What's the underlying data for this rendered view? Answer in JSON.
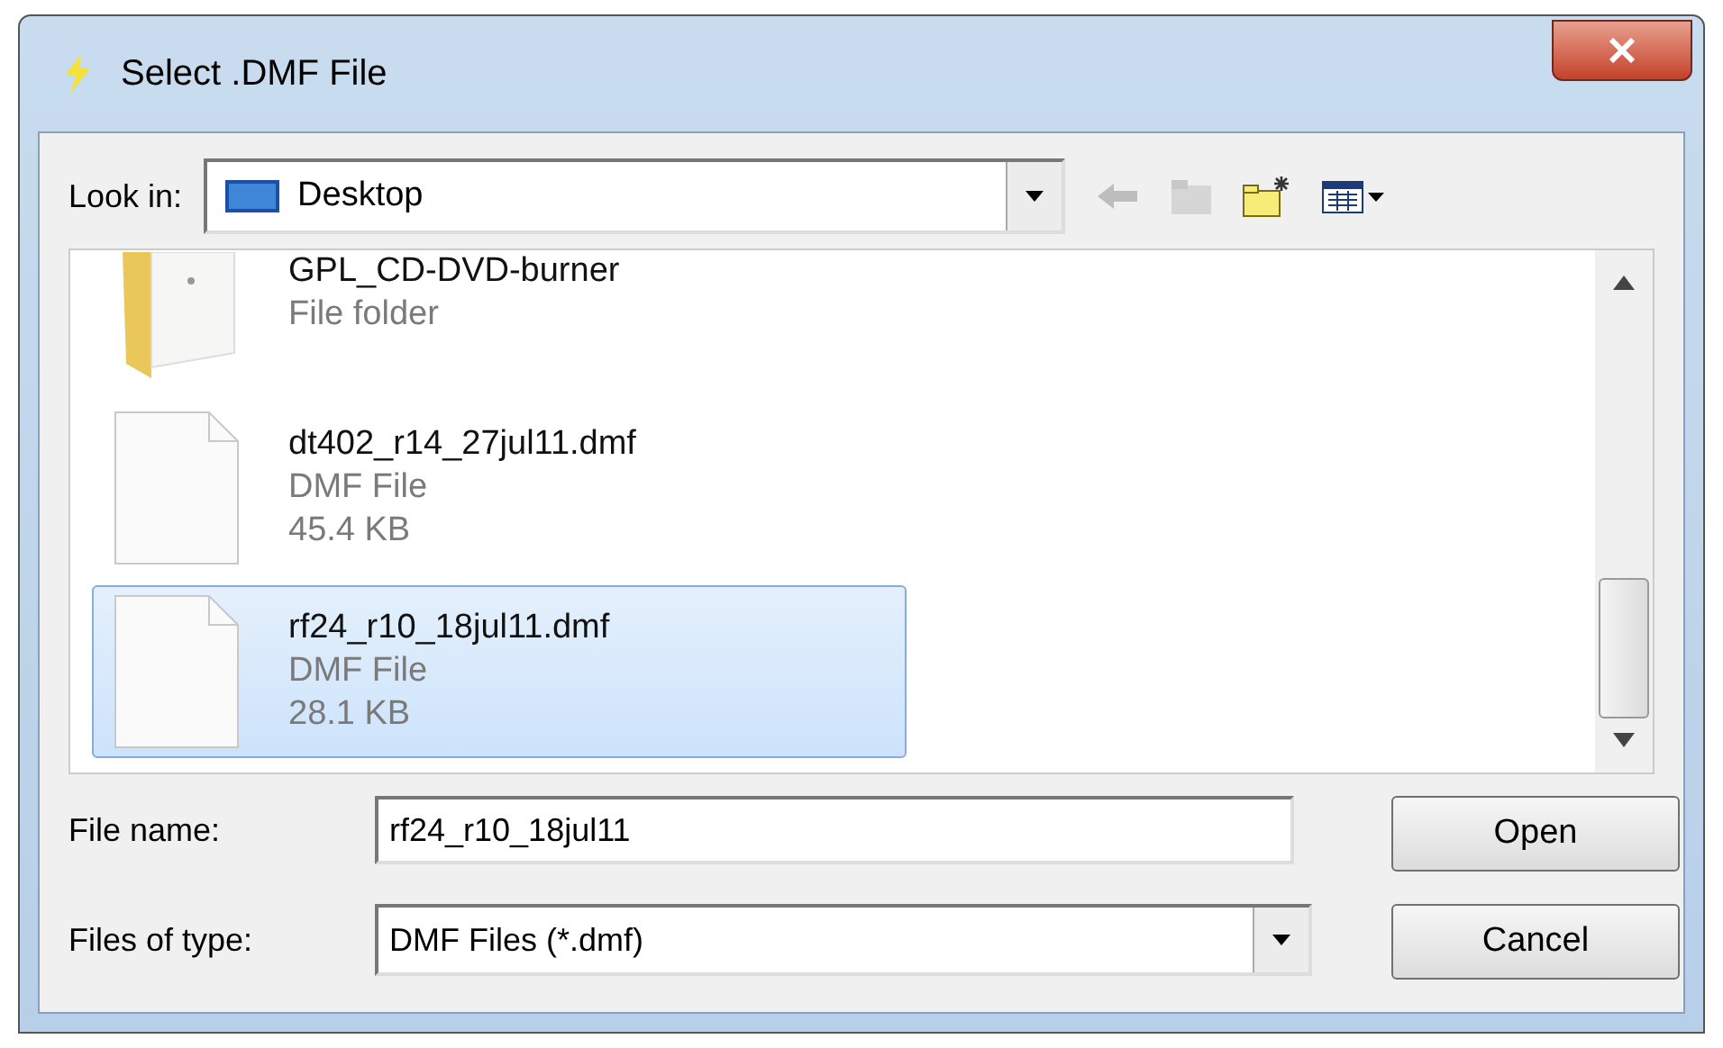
{
  "window": {
    "title": "Select .DMF File"
  },
  "look_in": {
    "label": "Look in:",
    "value": "Desktop"
  },
  "files": [
    {
      "kind": "folder",
      "name": "GPL_CD-DVD-burner",
      "type": "File folder",
      "selected": false
    },
    {
      "kind": "file",
      "name": "dt402_r14_27jul11.dmf",
      "type": "DMF File",
      "size": "45.4 KB",
      "selected": false
    },
    {
      "kind": "file",
      "name": "rf24_r10_18jul11.dmf",
      "type": "DMF File",
      "size": "28.1 KB",
      "selected": true
    }
  ],
  "file_name": {
    "label": "File name:",
    "value": "rf24_r10_18jul11"
  },
  "file_type": {
    "label": "Files of type:",
    "value": "DMF Files (*.dmf)"
  },
  "buttons": [
    "Open",
    "Cancel"
  ]
}
